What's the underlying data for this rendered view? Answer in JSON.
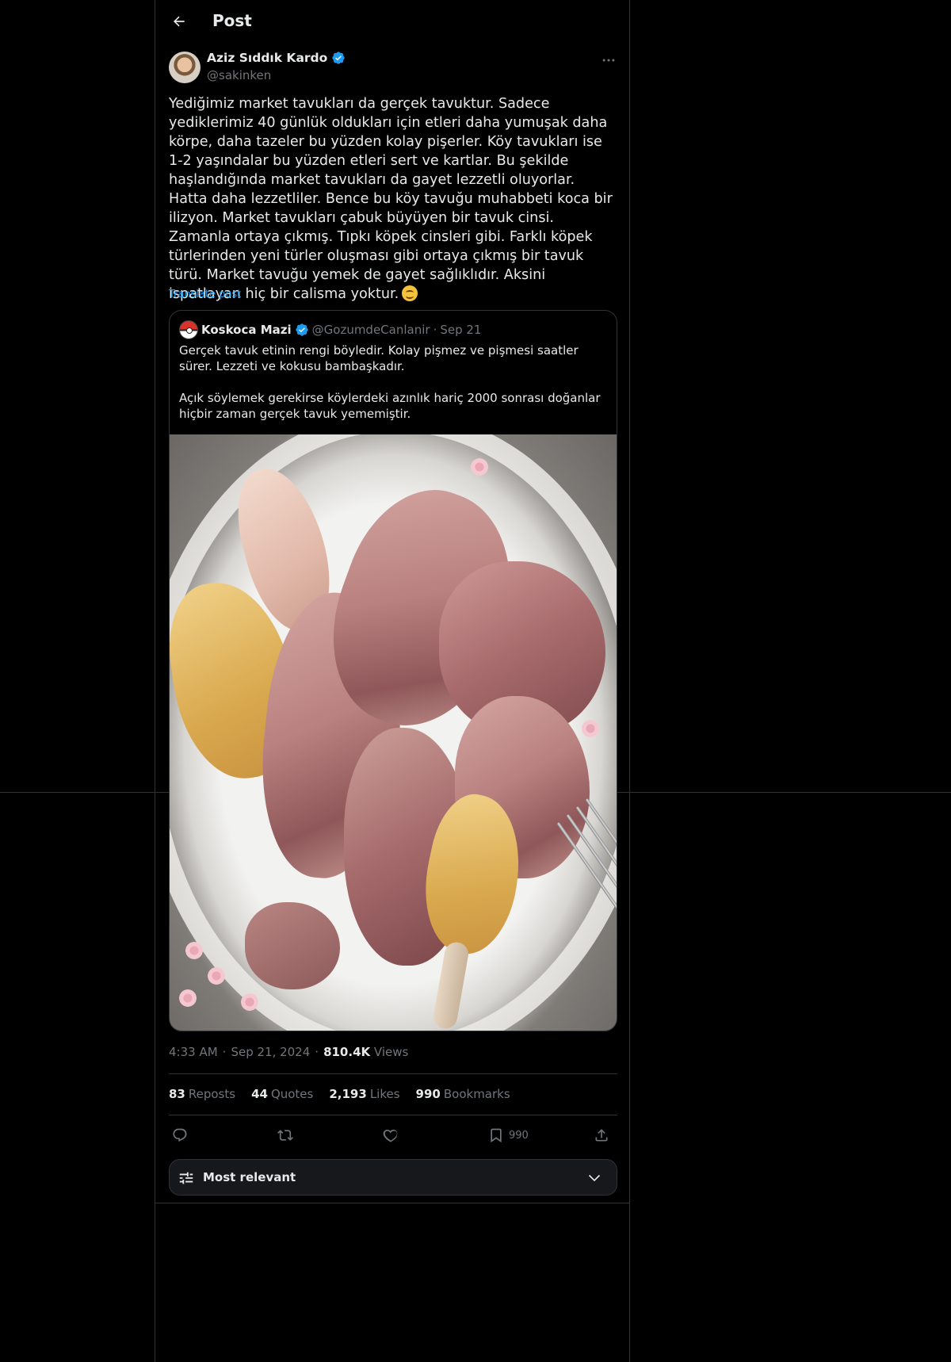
{
  "header": {
    "title": "Post"
  },
  "post": {
    "author_name": "Aziz Sıddık Kardo",
    "author_handle": "@sakinken",
    "text": "Yediğimiz market tavukları da gerçek tavuktur. Sadece yediklerimiz 40 günlük oldukları için etleri daha yumuşak daha körpe, daha tazeler bu yüzden kolay pişerler. Köy tavukları ise 1-2 yaşındalar bu yüzden etleri sert ve kartlar. Bu şekilde haşlandığında market tavukları da gayet lezzetli oluyorlar. Hatta daha lezzetliler. Bence bu köy tavuğu muhabbeti koca bir ilizyon. Market tavukları çabuk büyüyen bir tavuk cinsi. Zamanla ortaya çıkmış. Tıpkı köpek cinsleri gibi. Farklı köpek türlerinden yeni türler oluşması gibi ortaya çıkmış bir tavuk türü. Market tavuğu yemek de gayet sağlıklıdır. Aksini ispatlayan hiç bir calisma yoktur.",
    "translate_label": "Translate post",
    "time": "4:33 AM",
    "date": "Sep 21, 2024",
    "views_count": "810.4K",
    "views_label": "Views"
  },
  "quote": {
    "author_name": "Koskoca Mazi",
    "author_handle": "@GozumdeCanlanir",
    "dot": "·",
    "date": "Sep 21",
    "text": "Gerçek tavuk etinin rengi böyledir. Kolay pişmez ve pişmesi saatler sürer. Lezzeti ve kokusu bambaşkadır.\n\nAçık söylemek gerekirse köylerdeki azınlık hariç 2000 sonrası doğanlar hiçbir zaman gerçek tavuk yememiştir."
  },
  "meta": {
    "dot": "·"
  },
  "stats": [
    {
      "count": "83",
      "label": "Reposts"
    },
    {
      "count": "44",
      "label": "Quotes"
    },
    {
      "count": "2,193",
      "label": "Likes"
    },
    {
      "count": "990",
      "label": "Bookmarks"
    }
  ],
  "actions": {
    "reply_icon": "reply-icon",
    "repost_icon": "repost-icon",
    "like_icon": "heart-icon",
    "bookmark_icon": "bookmark-icon",
    "bookmark_count": "990",
    "share_icon": "share-icon"
  },
  "sort": {
    "label": "Most relevant"
  },
  "colors": {
    "accent": "#1d9bf0",
    "background": "#000000",
    "muted": "#71767b",
    "border": "#2f3336"
  }
}
